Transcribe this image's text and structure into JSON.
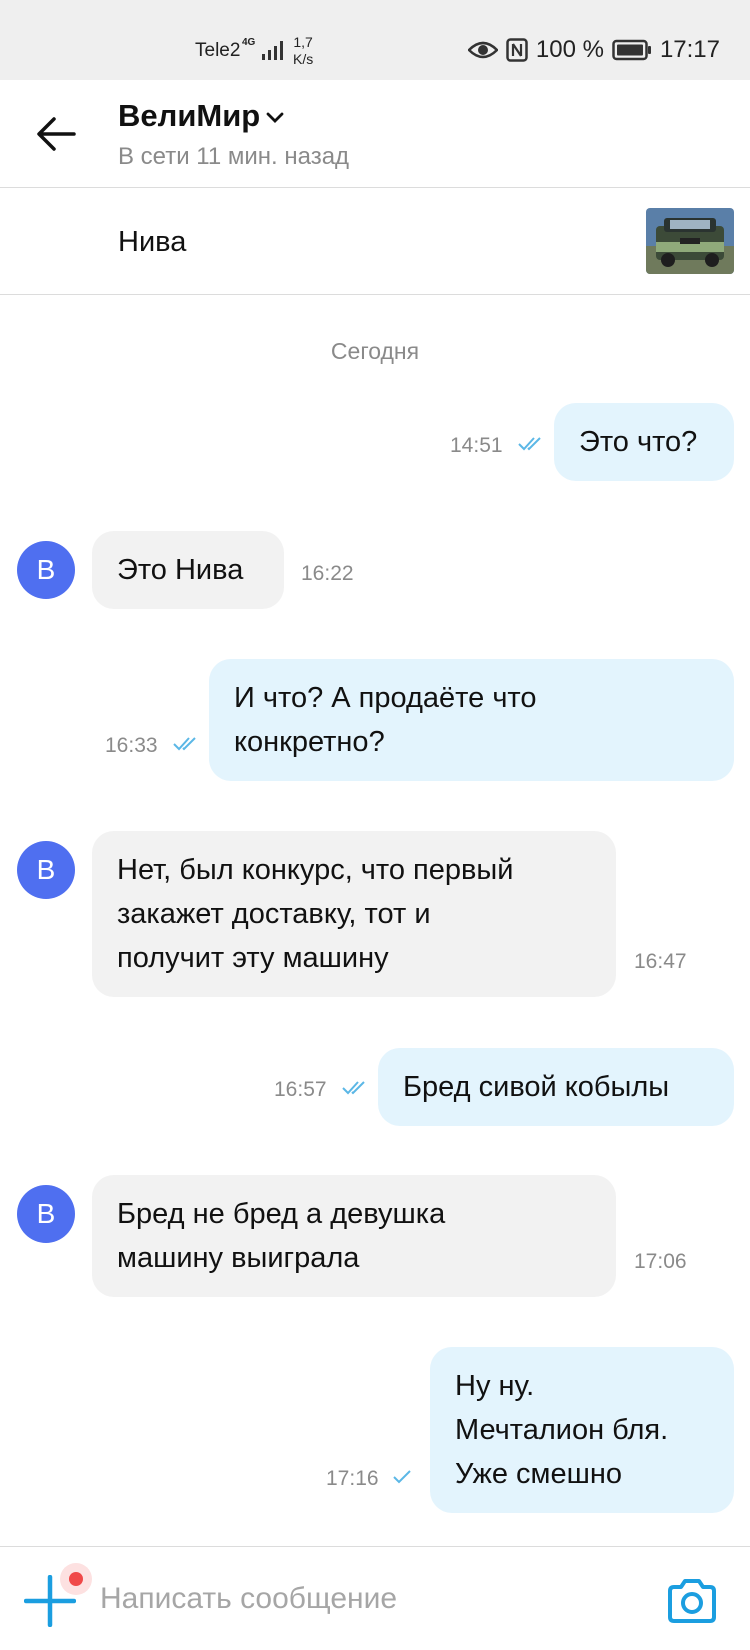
{
  "status_bar": {
    "carrier": "Tele2",
    "network": "4G",
    "speed_value": "1,7",
    "speed_unit": "K/s",
    "battery": "100 %",
    "time": "17:17"
  },
  "header": {
    "title": "ВелиМир",
    "subtitle": "В сети 11 мин. назад"
  },
  "listing": {
    "title": "Нива"
  },
  "chat": {
    "date_separator": "Сегодня",
    "messages": [
      {
        "direction": "out",
        "text": "Это что?",
        "time": "14:51",
        "status": "read"
      },
      {
        "direction": "in",
        "text": "Это Нива",
        "time": "16:22",
        "avatar": "В"
      },
      {
        "direction": "out",
        "lines": [
          "И что? А продаёте что",
          "конкретно?"
        ],
        "time": "16:33",
        "status": "read"
      },
      {
        "direction": "in",
        "lines": [
          "Нет, был конкурс, что первый",
          "закажет доставку, тот и",
          "получит эту машину"
        ],
        "time": "16:47",
        "avatar": "В"
      },
      {
        "direction": "out",
        "text": "Бред сивой кобылы",
        "time": "16:57",
        "status": "read"
      },
      {
        "direction": "in",
        "lines": [
          "Бред не бред а девушка",
          "машину выиграла"
        ],
        "time": "17:06",
        "avatar": "В"
      },
      {
        "direction": "out",
        "lines": [
          "Ну ну.",
          "Мечталион бля.",
          "Уже смешно"
        ],
        "time": "17:16",
        "status": "delivered"
      }
    ]
  },
  "composer": {
    "placeholder": "Написать сообщение"
  },
  "colors": {
    "accent": "#1b9ee0",
    "outgoing_bubble": "#e3f4fd",
    "incoming_bubble": "#f2f2f2",
    "avatar": "#4f6ff0",
    "notification": "#f04848"
  },
  "icons": {
    "back": "arrow-left-icon",
    "dropdown": "chevron-down-icon",
    "read": "double-check-icon",
    "delivered": "check-icon",
    "attach": "plus-icon",
    "camera": "camera-icon"
  }
}
